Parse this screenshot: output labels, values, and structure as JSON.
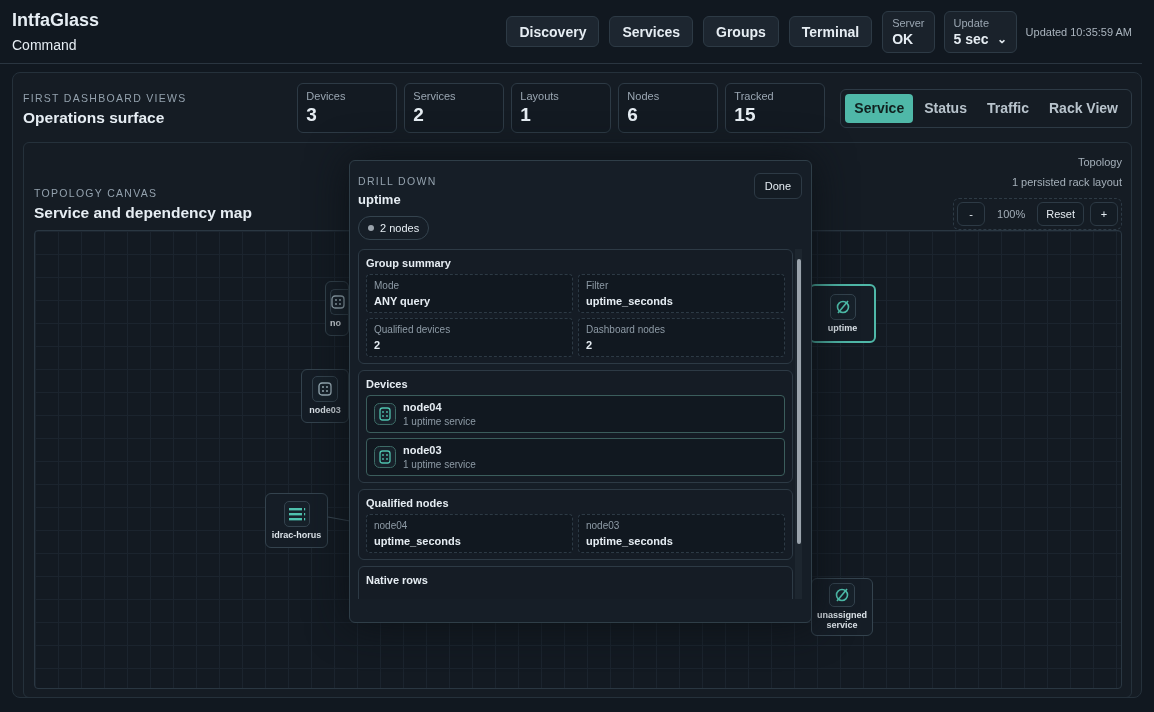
{
  "header": {
    "title": "IntfaGlass",
    "subtitle": "Command",
    "nav": [
      "Discovery",
      "Services",
      "Groups",
      "Terminal"
    ],
    "server": {
      "label": "Server",
      "value": "OK"
    },
    "update": {
      "label": "Update",
      "value": "5 sec",
      "caret": "⌄"
    },
    "updated": "Updated 10:35:59 AM"
  },
  "overview": {
    "eyebrow": "FIRST DASHBOARD VIEWS",
    "title": "Operations surface",
    "stats": [
      {
        "label": "Devices",
        "value": "3"
      },
      {
        "label": "Services",
        "value": "2"
      },
      {
        "label": "Layouts",
        "value": "1"
      },
      {
        "label": "Nodes",
        "value": "6"
      },
      {
        "label": "Tracked",
        "value": "15"
      }
    ],
    "tabs": [
      {
        "label": "Service",
        "selected": true
      },
      {
        "label": "Status",
        "selected": false
      },
      {
        "label": "Traffic",
        "selected": false
      },
      {
        "label": "Rack View",
        "selected": false
      }
    ]
  },
  "topology": {
    "eyebrow": "TOPOLOGY CANVAS",
    "title": "Service and dependency map",
    "mode": "Topology",
    "layouts": "1 persisted rack layout",
    "zoom": {
      "minus": "-",
      "value": "100%",
      "reset": "Reset",
      "plus": "+"
    },
    "nodes": [
      {
        "label": "no",
        "kind": "server",
        "selected": false
      },
      {
        "label": "node03",
        "kind": "server",
        "selected": false
      },
      {
        "label": "idrac-horus",
        "kind": "rack",
        "selected": false
      },
      {
        "label": "uptime",
        "kind": "service",
        "selected": true
      },
      {
        "label": "unassigned service",
        "kind": "service",
        "selected": false
      }
    ]
  },
  "drill": {
    "eyebrow": "DRILL DOWN",
    "title": "uptime",
    "done": "Done",
    "pill": "2 nodes",
    "summary": {
      "title": "Group summary",
      "fields": [
        {
          "label": "Mode",
          "value": "ANY query"
        },
        {
          "label": "Filter",
          "value": "uptime_seconds"
        },
        {
          "label": "Qualified devices",
          "value": "2"
        },
        {
          "label": "Dashboard nodes",
          "value": "2"
        }
      ]
    },
    "devices": {
      "title": "Devices",
      "items": [
        {
          "name": "node04",
          "detail": "1 uptime service"
        },
        {
          "name": "node03",
          "detail": "1 uptime service"
        }
      ]
    },
    "qualified": {
      "title": "Qualified nodes",
      "items": [
        {
          "node": "node04",
          "metric": "uptime_seconds"
        },
        {
          "node": "node03",
          "metric": "uptime_seconds"
        }
      ]
    },
    "native": {
      "title": "Native rows"
    }
  }
}
